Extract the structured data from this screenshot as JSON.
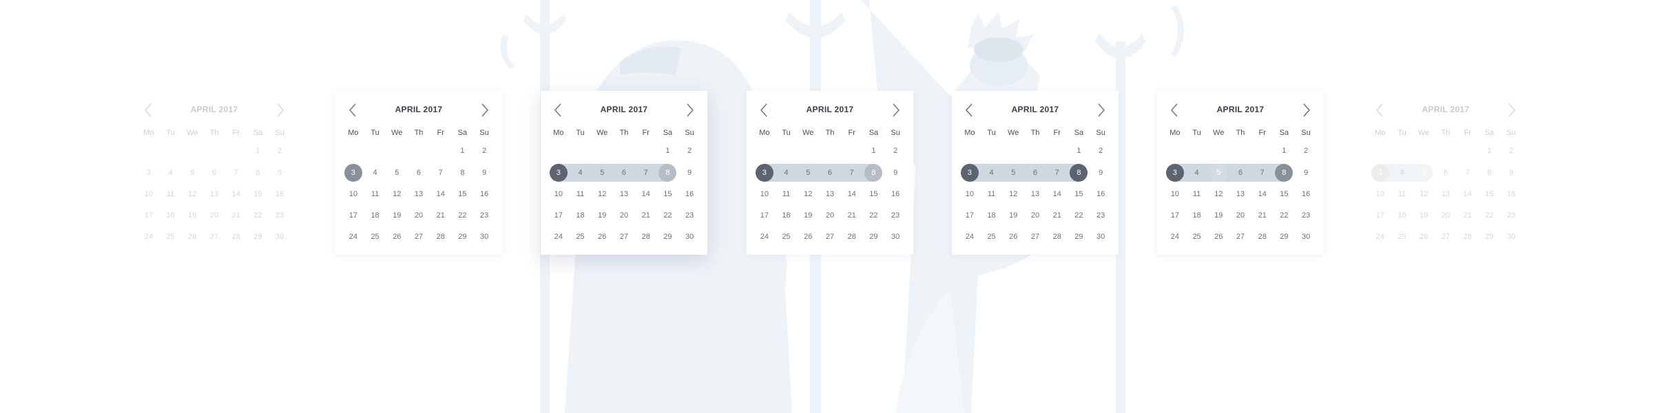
{
  "calendars": [
    {
      "title": "APRIL 2017",
      "weekdays": [
        "Mo",
        "Tu",
        "We",
        "Th",
        "Fr",
        "Sa",
        "Su"
      ],
      "weeks": [
        [
          "",
          "",
          "",
          "",
          "",
          "1",
          "2"
        ],
        [
          "3",
          "4",
          "5",
          "6",
          "7",
          "8",
          "9"
        ],
        [
          "10",
          "11",
          "12",
          "13",
          "14",
          "15",
          "16"
        ],
        [
          "17",
          "18",
          "19",
          "20",
          "21",
          "22",
          "23"
        ],
        [
          "24",
          "25",
          "26",
          "27",
          "28",
          "29",
          "30"
        ]
      ],
      "selection": "none",
      "visibility": "faded-left"
    },
    {
      "title": "APRIL 2017",
      "weekdays": [
        "Mo",
        "Tu",
        "We",
        "Th",
        "Fr",
        "Sa",
        "Su"
      ],
      "weeks": [
        [
          "",
          "",
          "",
          "",
          "",
          "1",
          "2"
        ],
        [
          "3",
          "4",
          "5",
          "6",
          "7",
          "8",
          "9"
        ],
        [
          "10",
          "11",
          "12",
          "13",
          "14",
          "15",
          "16"
        ],
        [
          "17",
          "18",
          "19",
          "20",
          "21",
          "22",
          "23"
        ],
        [
          "24",
          "25",
          "26",
          "27",
          "28",
          "29",
          "30"
        ]
      ],
      "selection": "start-only: 3",
      "visibility": "normal"
    },
    {
      "title": "APRIL 2017",
      "weekdays": [
        "Mo",
        "Tu",
        "We",
        "Th",
        "Fr",
        "Sa",
        "Su"
      ],
      "weeks": [
        [
          "",
          "",
          "",
          "",
          "",
          "1",
          "2"
        ],
        [
          "3",
          "4",
          "5",
          "6",
          "7",
          "8",
          "9"
        ],
        [
          "10",
          "11",
          "12",
          "13",
          "14",
          "15",
          "16"
        ],
        [
          "17",
          "18",
          "19",
          "20",
          "21",
          "22",
          "23"
        ],
        [
          "24",
          "25",
          "26",
          "27",
          "28",
          "29",
          "30"
        ]
      ],
      "selection": "range 3-8, hover end 8",
      "visibility": "elevated"
    },
    {
      "title": "APRIL 2017",
      "weekdays": [
        "Mo",
        "Tu",
        "We",
        "Th",
        "Fr",
        "Sa",
        "Su"
      ],
      "weeks": [
        [
          "",
          "",
          "",
          "",
          "",
          "1",
          "2"
        ],
        [
          "3",
          "4",
          "5",
          "6",
          "7",
          "8",
          "9"
        ],
        [
          "10",
          "11",
          "12",
          "13",
          "14",
          "15",
          "16"
        ],
        [
          "17",
          "18",
          "19",
          "20",
          "21",
          "22",
          "23"
        ],
        [
          "24",
          "25",
          "26",
          "27",
          "28",
          "29",
          "30"
        ]
      ],
      "selection": "range 3-8, hover end 8",
      "visibility": "normal"
    },
    {
      "title": "APRIL 2017",
      "weekdays": [
        "Mo",
        "Tu",
        "We",
        "Th",
        "Fr",
        "Sa",
        "Su"
      ],
      "weeks": [
        [
          "",
          "",
          "",
          "",
          "",
          "1",
          "2"
        ],
        [
          "3",
          "4",
          "5",
          "6",
          "7",
          "8",
          "9"
        ],
        [
          "10",
          "11",
          "12",
          "13",
          "14",
          "15",
          "16"
        ],
        [
          "17",
          "18",
          "19",
          "20",
          "21",
          "22",
          "23"
        ],
        [
          "24",
          "25",
          "26",
          "27",
          "28",
          "29",
          "30"
        ]
      ],
      "selection": "range 3-8 selected",
      "visibility": "normal"
    },
    {
      "title": "APRIL 2017",
      "weekdays": [
        "Mo",
        "Tu",
        "We",
        "Th",
        "Fr",
        "Sa",
        "Su"
      ],
      "weeks": [
        [
          "",
          "",
          "",
          "",
          "",
          "1",
          "2"
        ],
        [
          "3",
          "4",
          "5",
          "6",
          "7",
          "8",
          "9"
        ],
        [
          "10",
          "11",
          "12",
          "13",
          "14",
          "15",
          "16"
        ],
        [
          "17",
          "18",
          "19",
          "20",
          "21",
          "22",
          "23"
        ],
        [
          "24",
          "25",
          "26",
          "27",
          "28",
          "29",
          "30"
        ]
      ],
      "selection": "range 3-8 selected, hover 5",
      "visibility": "normal"
    },
    {
      "title": "APRIL 2017",
      "weekdays": [
        "Mo",
        "Tu",
        "We",
        "Th",
        "Fr",
        "Sa",
        "Su"
      ],
      "weeks": [
        [
          "",
          "",
          "",
          "",
          "",
          "1",
          "2"
        ],
        [
          "3",
          "4",
          "5",
          "6",
          "7",
          "8",
          "9"
        ],
        [
          "10",
          "11",
          "12",
          "13",
          "14",
          "15",
          "16"
        ],
        [
          "17",
          "18",
          "19",
          "20",
          "21",
          "22",
          "23"
        ],
        [
          "24",
          "25",
          "26",
          "27",
          "28",
          "29",
          "30"
        ]
      ],
      "selection": "range 3-5 selected",
      "visibility": "faded-right"
    }
  ],
  "icons": {
    "prev": "chevron-left-icon",
    "next": "chevron-right-icon"
  },
  "colors": {
    "accent_dark": "#5d6470",
    "accent_mid": "#8a9099",
    "range_band": "#cfd8e1",
    "text": "#3a3f47",
    "background_art": "#eef3f8"
  }
}
